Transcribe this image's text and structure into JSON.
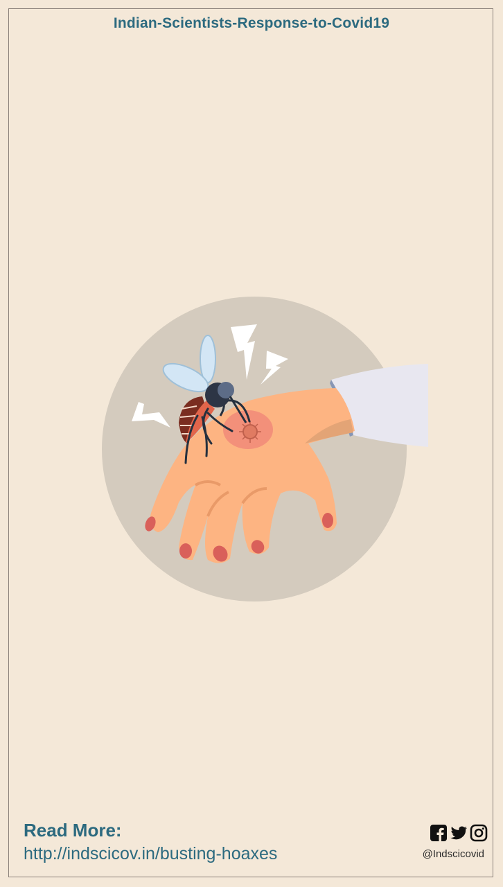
{
  "header": {
    "title": "Indian-Scientists-Response-to-Covid19"
  },
  "footer": {
    "read_more_label": "Read More:",
    "link_text": "http://indscicov.in/busting-hoaxes",
    "social_handle": "@Indscicovid",
    "social_icons": [
      "facebook-icon",
      "twitter-icon",
      "instagram-icon"
    ]
  },
  "colors": {
    "background": "#f4e8d8",
    "accent": "#2c6a7f",
    "circle": "#d4cbbe",
    "skin": "#fdb482",
    "nail": "#d9605a"
  }
}
